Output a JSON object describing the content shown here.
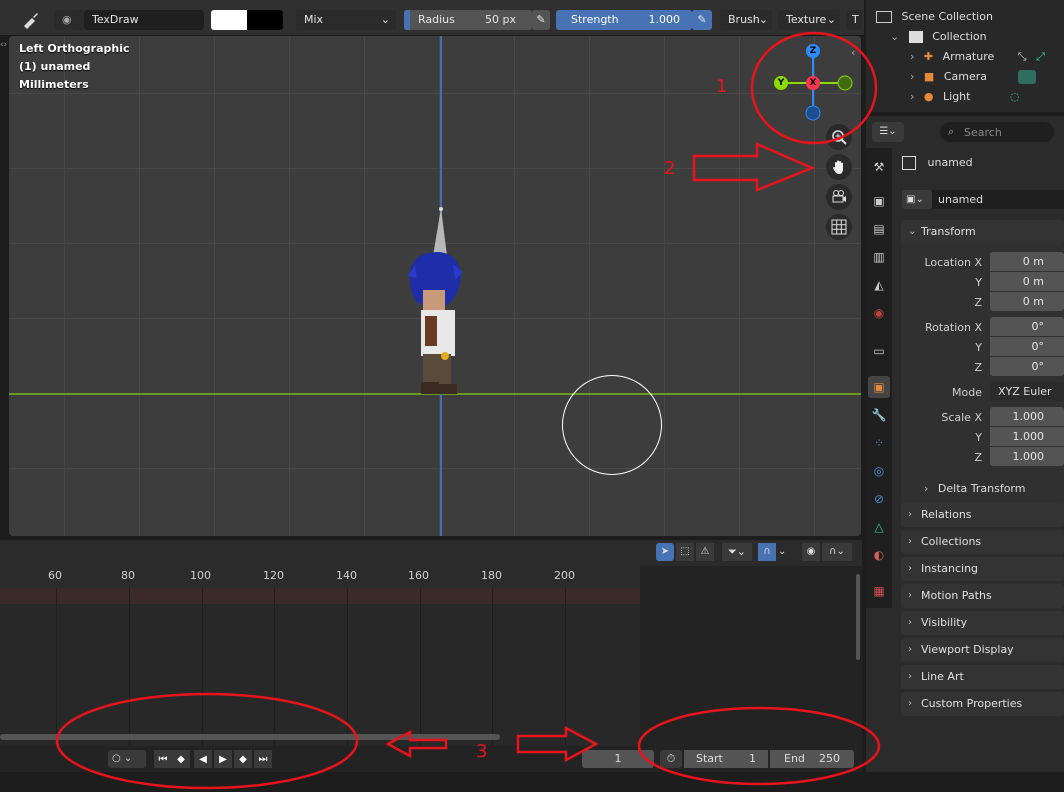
{
  "header": {
    "brush_name": "TexDraw",
    "blend_mode": "Mix",
    "radius_label": "Radius",
    "radius_value": "50 px",
    "strength_label": "Strength",
    "strength_value": "1.000",
    "brush_menu": "Brush",
    "texture_menu": "Texture",
    "truncated_menu": "T"
  },
  "viewport": {
    "view_name": "Left Orthographic",
    "object_name": "(1) unamed",
    "units": "Millimeters",
    "gizmo": {
      "z": "Z",
      "y": "Y",
      "x": "X"
    }
  },
  "annotations": {
    "one": "1",
    "two": "2",
    "three": "3"
  },
  "outliner": {
    "scene_collection": "Scene Collection",
    "collection": "Collection",
    "items": [
      {
        "label": "Armature"
      },
      {
        "label": "Camera"
      },
      {
        "label": "Light"
      }
    ]
  },
  "properties": {
    "search_placeholder": "Search",
    "object_name": "unamed",
    "datablock_name": "unamed",
    "transform_label": "Transform",
    "location_x_label": "Location X",
    "location_x": "0 m",
    "location_y_label": "Y",
    "location_y": "0 m",
    "location_z_label": "Z",
    "location_z": "0 m",
    "rotation_x_label": "Rotation X",
    "rotation_x": "0°",
    "rotation_y_label": "Y",
    "rotation_y": "0°",
    "rotation_z_label": "Z",
    "rotation_z": "0°",
    "mode_label": "Mode",
    "mode_value": "XYZ Euler",
    "scale_x_label": "Scale X",
    "scale_x": "1.000",
    "scale_y_label": "Y",
    "scale_y": "1.000",
    "scale_z_label": "Z",
    "scale_z": "1.000",
    "delta_transform": "Delta Transform",
    "panels": [
      "Relations",
      "Collections",
      "Instancing",
      "Motion Paths",
      "Visibility",
      "Viewport Display",
      "Line Art",
      "Custom Properties"
    ]
  },
  "timeline": {
    "frames": [
      "60",
      "80",
      "100",
      "120",
      "140",
      "160",
      "180",
      "200"
    ],
    "current_frame": "1",
    "start_label": "Start",
    "start_value": "1",
    "end_label": "End",
    "end_value": "250"
  },
  "colors": {
    "annotation_red": "#e8141b",
    "blue_field": "#4772b3",
    "x_axis": "#ff3352",
    "y_axis": "#8bdc00",
    "z_axis": "#2b8cff"
  }
}
